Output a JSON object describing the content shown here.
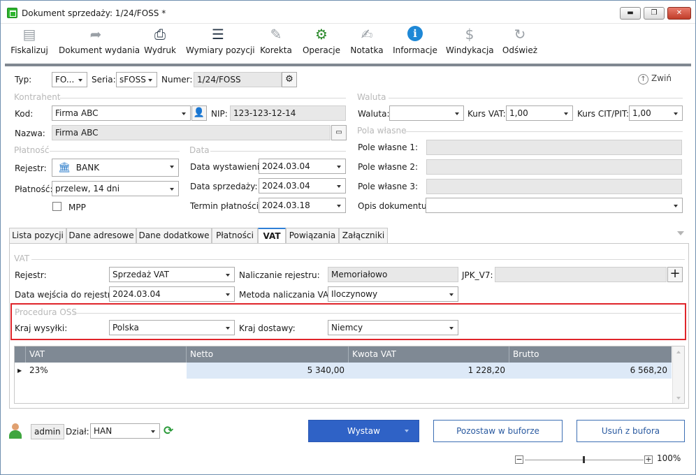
{
  "window": {
    "title": "Dokument sprzedaży: 1/24/FOSS *",
    "min": "▬",
    "max": "❐",
    "close": "✕"
  },
  "toolbar": {
    "items": [
      {
        "label": "Fiskalizuj",
        "icon": "cash-register-icon",
        "glyph": "▤",
        "color": "#9aa0a6"
      },
      {
        "label": "Dokument wydania",
        "icon": "document-arrow-icon",
        "glyph": "➦",
        "color": "#9aa0a6"
      },
      {
        "label": "Wydruk",
        "icon": "printer-icon",
        "glyph": "⎙",
        "color": "#2b3a4a"
      },
      {
        "label": "Wymiary pozycji",
        "icon": "list-icon",
        "glyph": "☰",
        "color": "#2b3a4a"
      },
      {
        "label": "Korekta",
        "icon": "pencil-icon",
        "glyph": "✎",
        "color": "#9aa0a6"
      },
      {
        "label": "Operacje",
        "icon": "gears-icon",
        "glyph": "⚙",
        "color": "#2b8a2b"
      },
      {
        "label": "Notatka",
        "icon": "note-icon",
        "glyph": "✍",
        "color": "#9aa0a6"
      },
      {
        "label": "Informacje",
        "icon": "info-icon",
        "glyph": "ℹ",
        "color": "#1e88d6"
      },
      {
        "label": "Windykacja",
        "icon": "debt-collection-icon",
        "glyph": "$",
        "color": "#9aa0a6"
      },
      {
        "label": "Odśwież",
        "icon": "refresh-icon",
        "glyph": "↻",
        "color": "#9aa0a6"
      }
    ]
  },
  "header": {
    "typ_label": "Typ:",
    "typ_value": "FO...",
    "seria_label": "Seria:",
    "seria_value": "sFOSS",
    "numer_label": "Numer:",
    "numer_value": "1/24/FOSS",
    "collapse_label": "Zwiń"
  },
  "kontrahent": {
    "group": "Kontrahent",
    "kod_label": "Kod:",
    "kod_value": "Firma ABC",
    "nip_label": "NIP:",
    "nip_value": "123-123-12-14",
    "nazwa_label": "Nazwa:",
    "nazwa_value": "Firma ABC"
  },
  "waluta": {
    "group": "Waluta",
    "waluta_label": "Waluta:",
    "waluta_value": "",
    "kurs_vat_label": "Kurs VAT:",
    "kurs_vat_value": "1,00",
    "kurs_cit_label": "Kurs CIT/PIT:",
    "kurs_cit_value": "1,00"
  },
  "pola": {
    "group": "Pola własne",
    "p1": "Pole własne 1:",
    "p2": "Pole własne 2:",
    "p3": "Pole własne 3:",
    "opis": "Opis dokumentu:"
  },
  "platnosc": {
    "group": "Płatność",
    "rejestr_label": "Rejestr:",
    "rejestr_value": "BANK",
    "platnosc_label": "Płatność:",
    "platnosc_value": "przelew, 14 dni",
    "mpp_label": "MPP"
  },
  "data": {
    "group": "Data",
    "wyst_label": "Data wystawienia:",
    "wyst_value": "2024.03.04",
    "sprz_label": "Data sprzedaży:",
    "sprz_value": "2024.03.04",
    "termin_label": "Termin płatności:",
    "termin_value": "2024.03.18"
  },
  "tabs": [
    "Lista pozycji",
    "Dane adresowe",
    "Dane dodatkowe",
    "Płatności",
    "VAT",
    "Powiązania",
    "Załączniki"
  ],
  "vat": {
    "group": "VAT",
    "rejestr_label": "Rejestr:",
    "rejestr_value": "Sprzedaż VAT",
    "nalicz_rej_label": "Naliczanie rejestru:",
    "nalicz_rej_value": "Memoriałowo",
    "jpk_label": "JPK_V7:",
    "jpk_value": "",
    "data_wejscia_label": "Data wejścia do rejestru:",
    "data_wejscia_value": "2024.03.04",
    "metoda_label": "Metoda naliczania VAT:",
    "metoda_value": "Iloczynowy"
  },
  "oss": {
    "group": "Procedura OSS",
    "kraj_wysylki_label": "Kraj wysyłki:",
    "kraj_wysylki_value": "Polska",
    "kraj_dostawy_label": "Kraj dostawy:",
    "kraj_dostawy_value": "Niemcy"
  },
  "grid": {
    "columns": [
      "VAT",
      "Netto",
      "Kwota VAT",
      "Brutto"
    ],
    "rows": [
      {
        "vat": "23%",
        "netto": "5 340,00",
        "kwota": "1 228,20",
        "brutto": "6 568,20"
      }
    ]
  },
  "footer": {
    "user": "admin",
    "dzial_label": "Dział:",
    "dzial_value": "HAN",
    "wystaw": "Wystaw",
    "pozostaw": "Pozostaw w buforze",
    "usun": "Usuń z bufora",
    "zoom": "100%"
  },
  "colors": {
    "accent": "#2f62c6",
    "highlight": "#e0252b"
  }
}
